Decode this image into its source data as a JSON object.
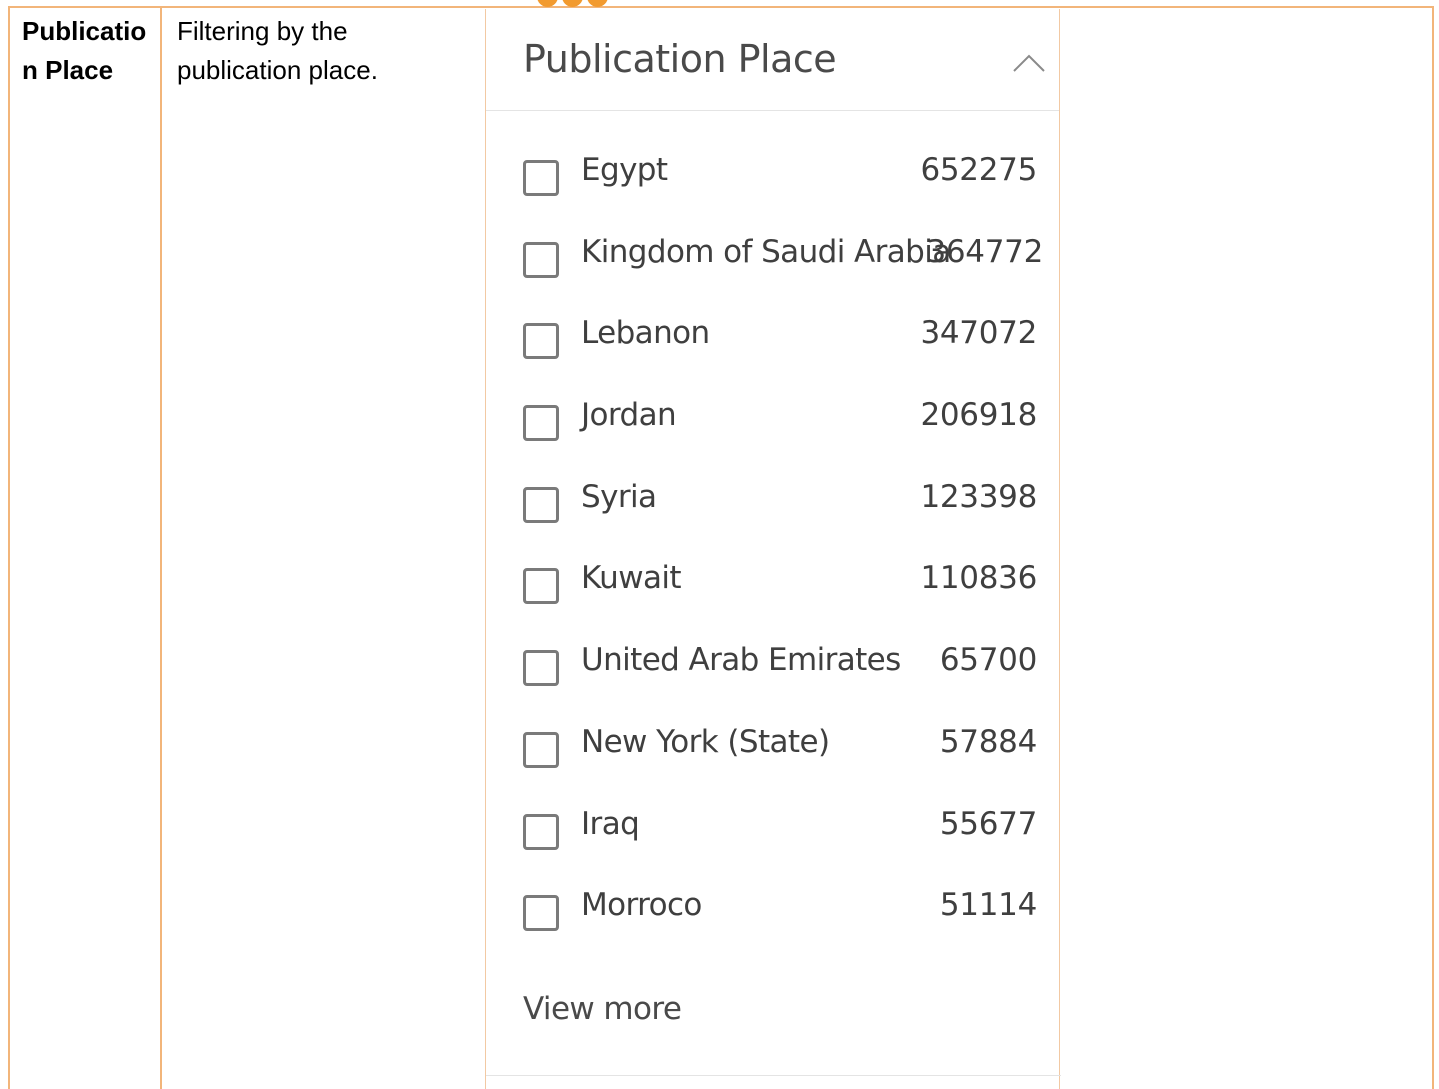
{
  "table": {
    "label": "Publication Place",
    "description": "Filtering by the publication place."
  },
  "panel": {
    "title": "Publication Place",
    "toggle_icon": "chevron-up-icon",
    "options": [
      {
        "label": "Egypt",
        "count": "652275"
      },
      {
        "label": "Kingdom of Saudi Arabia",
        "count": "364772"
      },
      {
        "label": "Lebanon",
        "count": "347072"
      },
      {
        "label": "Jordan",
        "count": "206918"
      },
      {
        "label": "Syria",
        "count": "123398"
      },
      {
        "label": "Kuwait",
        "count": "110836"
      },
      {
        "label": "United Arab Emirates",
        "count": "65700"
      },
      {
        "label": "New York (State)",
        "count": "57884"
      },
      {
        "label": "Iraq",
        "count": "55677"
      },
      {
        "label": "Morroco",
        "count": "51114"
      }
    ],
    "view_more": "View more"
  },
  "colors": {
    "table_border": "#f2b57a",
    "accent_dots": "#f29a2e",
    "text": "#3f3f3f"
  }
}
